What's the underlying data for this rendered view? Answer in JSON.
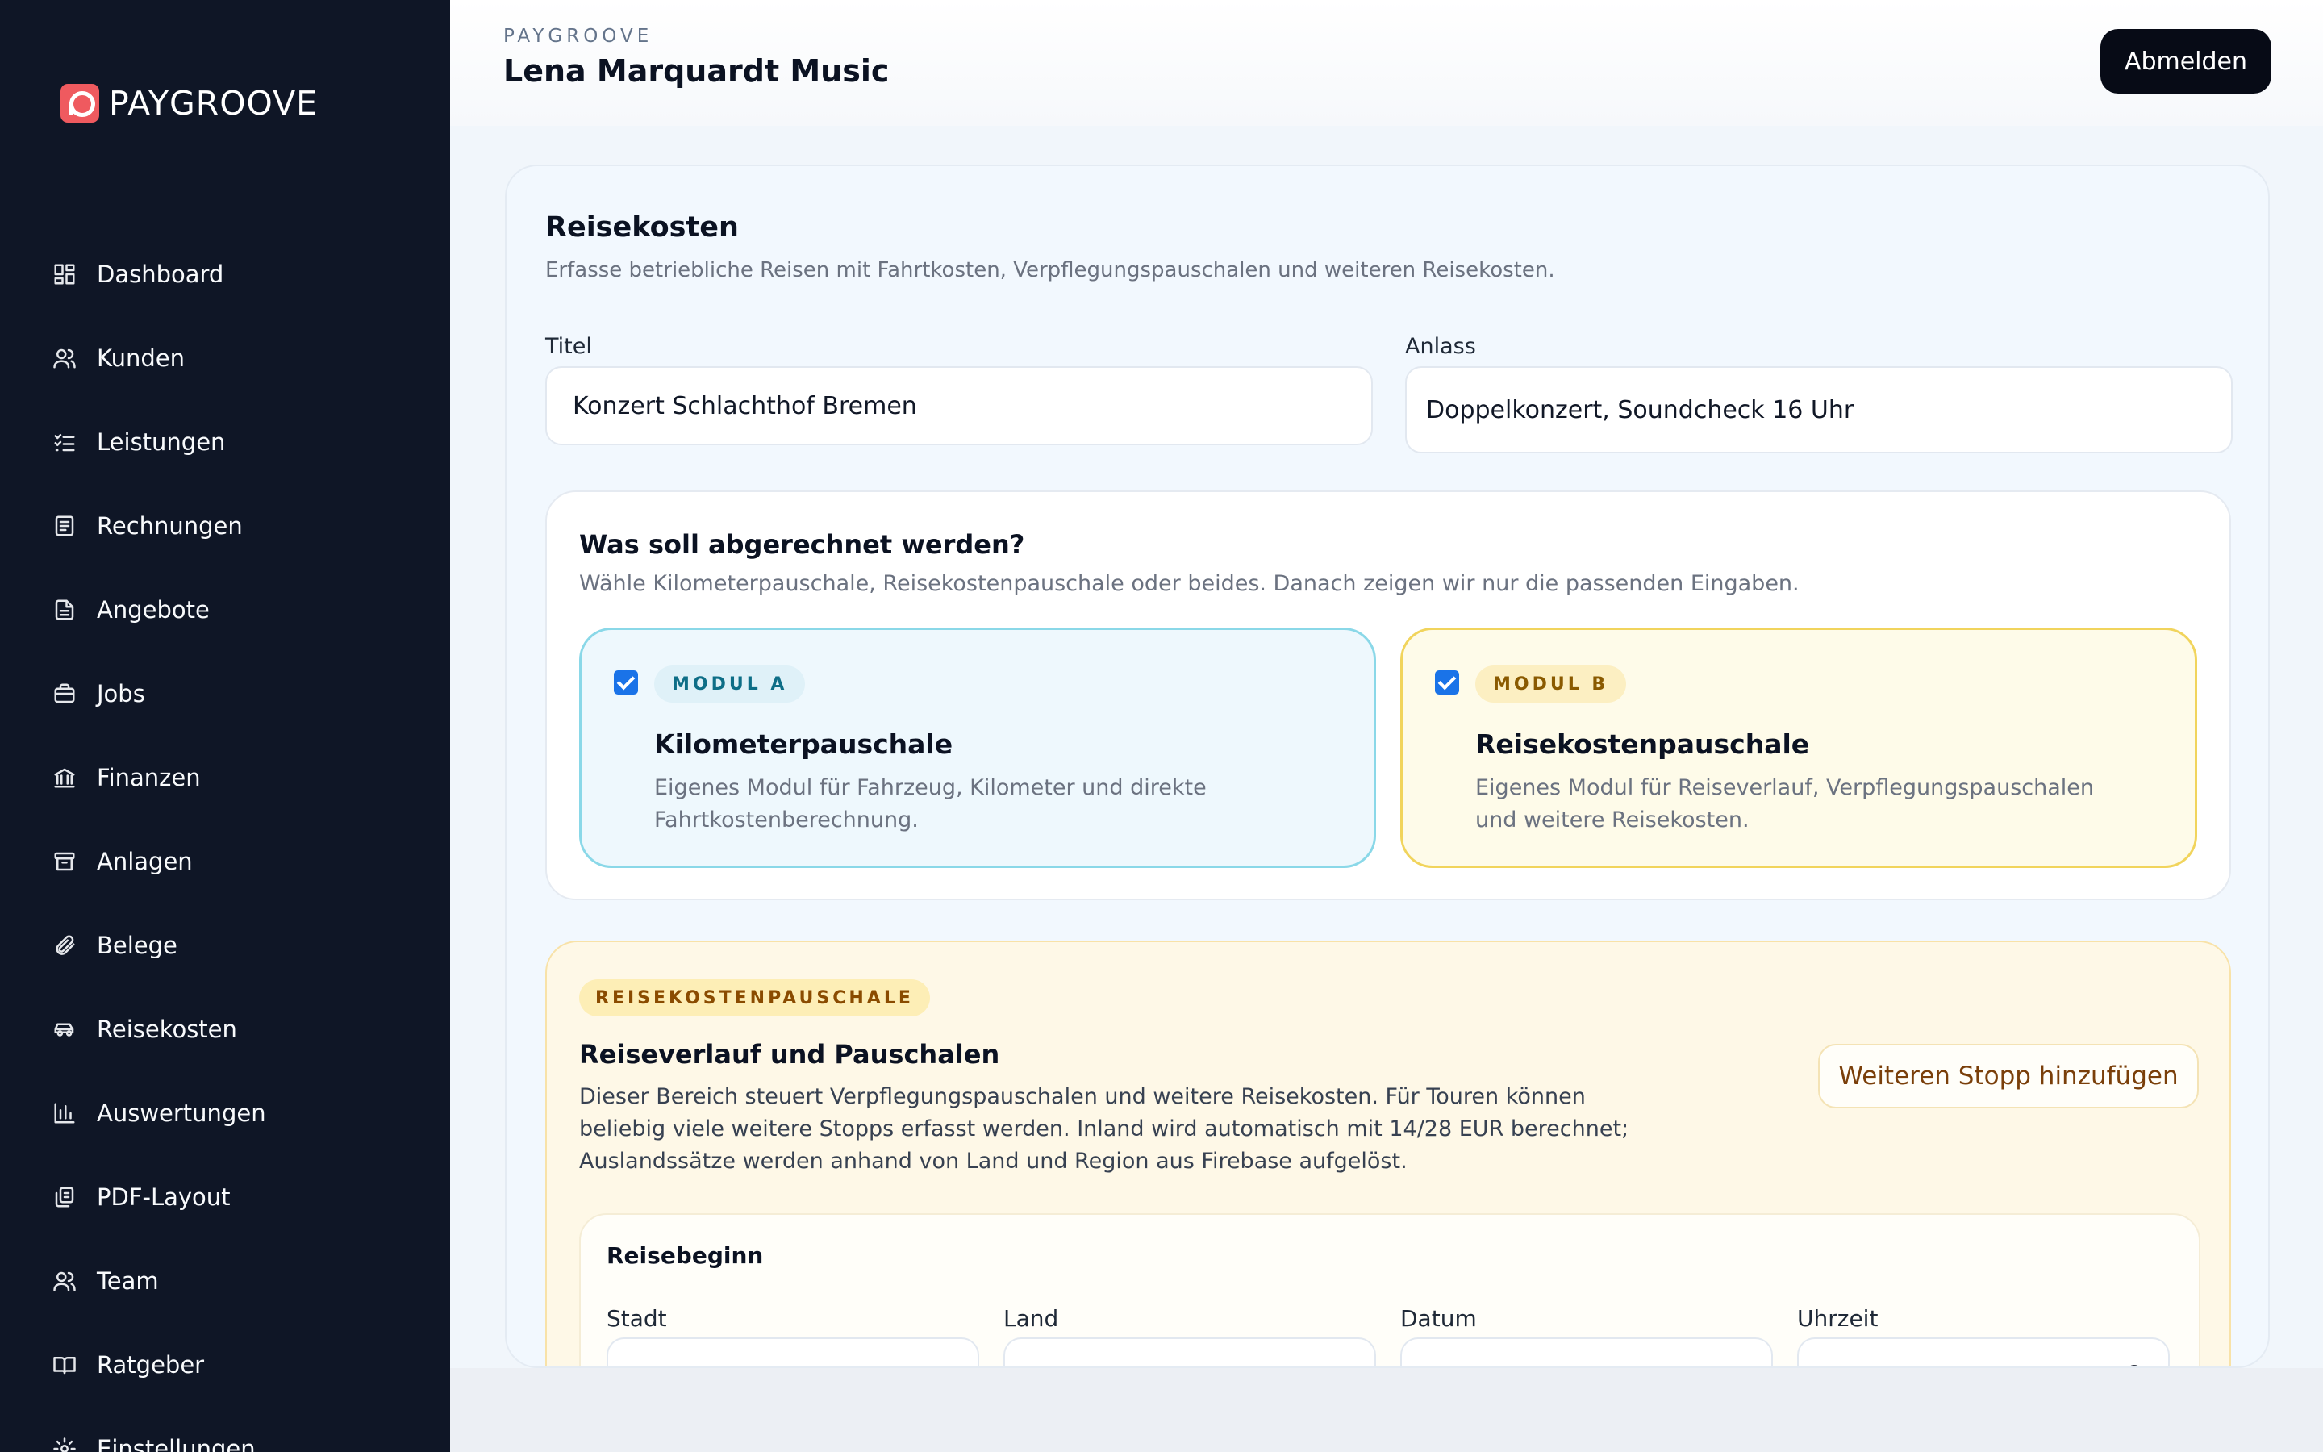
{
  "brand": {
    "name": "PAYGROOVE",
    "icon": "paygroove-logo-icon"
  },
  "sidebar": {
    "items": [
      {
        "label": "Dashboard",
        "icon": "dashboard-icon"
      },
      {
        "label": "Kunden",
        "icon": "users-icon"
      },
      {
        "label": "Leistungen",
        "icon": "checklist-icon"
      },
      {
        "label": "Rechnungen",
        "icon": "invoice-icon"
      },
      {
        "label": "Angebote",
        "icon": "document-icon"
      },
      {
        "label": "Jobs",
        "icon": "briefcase-icon"
      },
      {
        "label": "Finanzen",
        "icon": "bank-icon"
      },
      {
        "label": "Anlagen",
        "icon": "archive-icon"
      },
      {
        "label": "Belege",
        "icon": "paperclip-icon"
      },
      {
        "label": "Reisekosten",
        "icon": "car-icon"
      },
      {
        "label": "Auswertungen",
        "icon": "bar-chart-icon"
      },
      {
        "label": "PDF-Layout",
        "icon": "pdf-layout-icon"
      },
      {
        "label": "Team",
        "icon": "team-icon"
      },
      {
        "label": "Ratgeber",
        "icon": "book-icon"
      },
      {
        "label": "Einstellungen",
        "icon": "gear-icon"
      }
    ]
  },
  "header": {
    "kicker": "PAYGROOVE",
    "company": "Lena Marquardt Music",
    "logout_label": "Abmelden"
  },
  "form": {
    "title": "Reisekosten",
    "subtitle": "Erfasse betriebliche Reisen mit Fahrtkosten, Verpflegungspauschalen und weiteren Reisekosten.",
    "titel_label": "Titel",
    "titel_value": "Konzert Schlachthof Bremen",
    "anlass_label": "Anlass",
    "anlass_value": "Doppelkonzert, Soundcheck 16 Uhr"
  },
  "billing": {
    "question": "Was soll abgerechnet werden?",
    "hint": "Wähle Kilometerpauschale, Reisekostenpauschale oder beides. Danach zeigen wir nur die passenden Eingaben.",
    "modules": [
      {
        "badge": "MODUL A",
        "title": "Kilometerpauschale",
        "desc": "Eigenes Modul für Fahrzeug, Kilometer und direkte Fahrtkostenberechnung.",
        "checked": true,
        "accent": "#8ad8e8"
      },
      {
        "badge": "MODUL B",
        "title": "Reisekostenpauschale",
        "desc": "Eigenes Modul für Reiseverlauf, Verpflegungspauschalen und weitere Reisekosten.",
        "checked": true,
        "accent": "#f1d45c"
      }
    ]
  },
  "travel": {
    "badge": "REISEKOSTENPAUSCHALE",
    "title": "Reiseverlauf und Pauschalen",
    "desc": "Dieser Bereich steuert Verpflegungspauschalen und weitere Reisekosten. Für Touren können beliebig viele weitere Stopps erfasst werden. Inland wird automatisch mit 14/28 EUR berechnet; Auslandssätze werden anhand von Land und Region aus Firebase aufgelöst.",
    "add_stop_label": "Weiteren Stopp hinzufügen",
    "start": {
      "title": "Reisebeginn",
      "stadt_label": "Stadt",
      "land_label": "Land",
      "datum_label": "Datum",
      "uhrzeit_label": "Uhrzeit"
    }
  },
  "colors": {
    "sidebar_bg": "#0f1626",
    "brand": "#ef5a5f",
    "checkbox": "#1a73e8"
  }
}
